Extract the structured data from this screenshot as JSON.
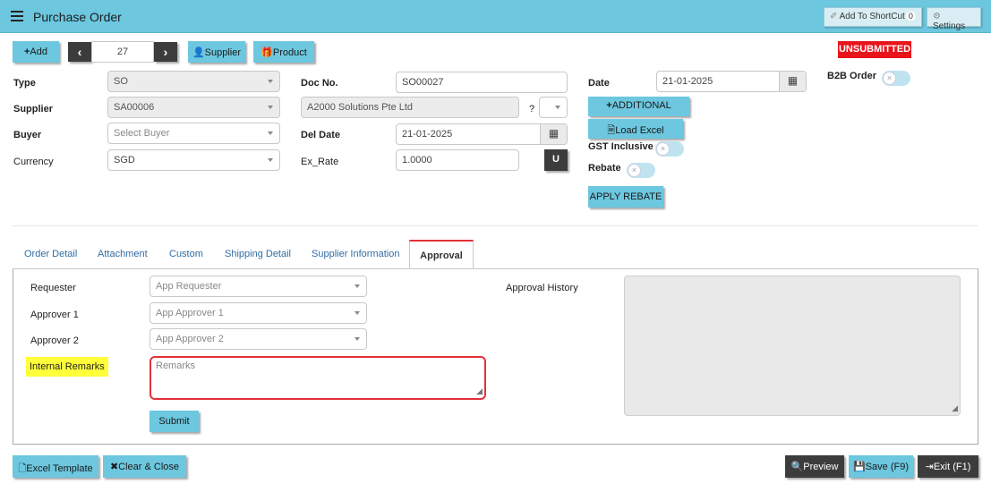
{
  "header": {
    "title": "Purchase Order",
    "add_shortcut_label": "Add To ShortCut",
    "shortcut_count": "0",
    "settings_label": "Settings"
  },
  "toolbar": {
    "add_label": "Add",
    "record_number": "27",
    "supplier_label": "Supplier",
    "product_label": "Product"
  },
  "status_badge": "UNSUBMITTED",
  "form": {
    "type_label": "Type",
    "type_value": "SO",
    "supplier_label": "Supplier",
    "supplier_value": "SA00006",
    "buyer_label": "Buyer",
    "buyer_placeholder": "Select Buyer",
    "currency_label": "Currency",
    "currency_value": "SGD",
    "doc_no_label": "Doc No.",
    "doc_no_value": "SO00027",
    "supplier_name_value": "A2000 Solutions Pte Ltd",
    "question_mark": "?",
    "del_date_label": "Del Date",
    "del_date_value": "21-01-2025",
    "ex_rate_label": "Ex_Rate",
    "ex_rate_value": "1.0000",
    "u_button": "U",
    "date_label": "Date",
    "date_value": "21-01-2025",
    "additional_label": "ADDITIONAL",
    "load_excel_label": "Load Excel",
    "gst_inclusive_label": "GST Inclusive",
    "rebate_label": "Rebate",
    "apply_rebate_label": "APPLY REBATE",
    "b2b_order_label": "B2B Order"
  },
  "tabs": [
    {
      "label": "Order Detail"
    },
    {
      "label": "Attachment"
    },
    {
      "label": "Custom"
    },
    {
      "label": "Shipping Detail"
    },
    {
      "label": "Supplier Information"
    },
    {
      "label": "Approval"
    }
  ],
  "approval": {
    "requester_label": "Requester",
    "requester_placeholder": "App Requester",
    "approver1_label": "Approver 1",
    "approver1_placeholder": "App Approver 1",
    "approver2_label": "Approver 2",
    "approver2_placeholder": "App Approver 2",
    "internal_remarks_label": "Internal Remarks",
    "remarks_placeholder": "Remarks",
    "submit_label": "Submit",
    "history_label": "Approval History"
  },
  "footer": {
    "excel_template_label": "Excel Template",
    "clear_close_label": "Clear & Close",
    "preview_label": "Preview",
    "save_label": "Save (F9)",
    "exit_label": "Exit (F1)"
  },
  "colors": {
    "accent": "#6cc7df",
    "status_red": "#e8141b",
    "highlight": "#ffff3a",
    "dark_button": "#3c3c3c"
  }
}
